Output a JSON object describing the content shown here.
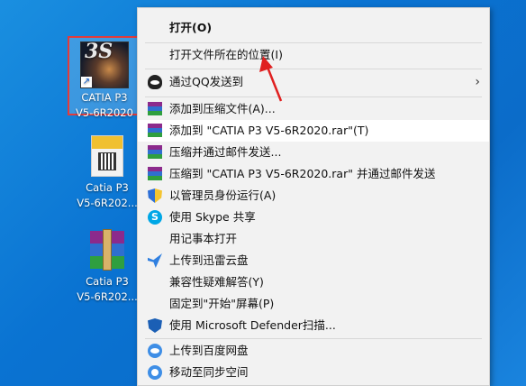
{
  "desktop": {
    "icons": [
      {
        "label_line1": "CATIA P3",
        "label_line2": "V5-6R2020"
      },
      {
        "label_line1": "Catia P3",
        "label_line2": "V5-6R202..."
      },
      {
        "label_line1": "Catia P3",
        "label_line2": "V5-6R202..."
      }
    ]
  },
  "context_menu": {
    "items": [
      {
        "label": "打开(O)"
      },
      {
        "label": "打开文件所在的位置(I)"
      },
      {
        "label": "通过QQ发送到",
        "submenu_arrow": "›"
      },
      {
        "label": "添加到压缩文件(A)..."
      },
      {
        "label": "添加到 \"CATIA P3 V5-6R2020.rar\"(T)"
      },
      {
        "label": "压缩并通过邮件发送..."
      },
      {
        "label": "压缩到 \"CATIA P3 V5-6R2020.rar\" 并通过邮件发送"
      },
      {
        "label": "以管理员身份运行(A)"
      },
      {
        "label": "使用 Skype 共享",
        "icon_text": "S"
      },
      {
        "label": "用记事本打开"
      },
      {
        "label": "上传到迅雷云盘"
      },
      {
        "label": "兼容性疑难解答(Y)"
      },
      {
        "label": "固定到\"开始\"屏幕(P)"
      },
      {
        "label": "使用 Microsoft Defender扫描..."
      },
      {
        "label": "上传到百度网盘"
      },
      {
        "label": "移动至同步空间"
      }
    ]
  },
  "colors": {
    "desktop_bg": "#0b6cc9",
    "selection_border": "#e23b3b",
    "annotation_arrow": "#e02020",
    "menu_bg": "#f2f2f2"
  }
}
